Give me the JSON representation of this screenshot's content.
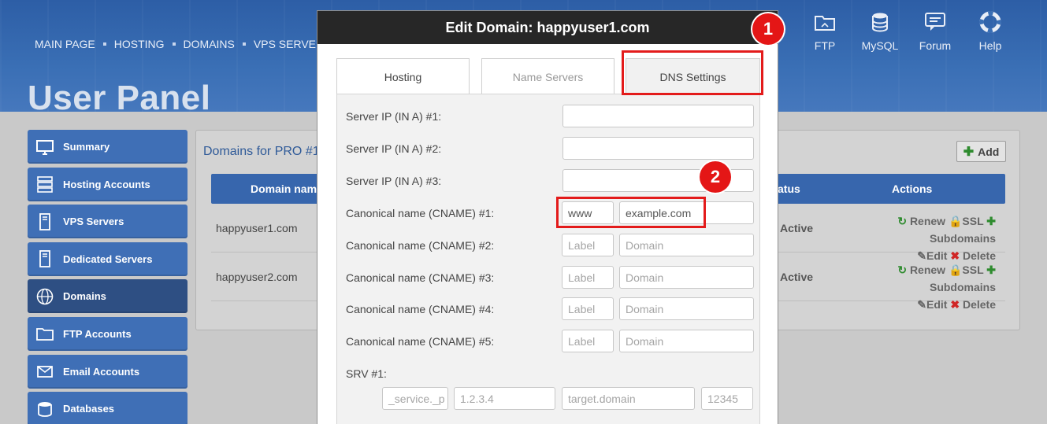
{
  "top_nav": {
    "items": [
      "MAIN PAGE",
      "HOSTING",
      "DOMAINS",
      "VPS SERVERS"
    ]
  },
  "header": {
    "title": "User Panel"
  },
  "top_icons": [
    {
      "label": "FTP",
      "icon": "ftp-folder-icon"
    },
    {
      "label": "MySQL",
      "icon": "database-icon"
    },
    {
      "label": "Forum",
      "icon": "chat-icon"
    },
    {
      "label": "Help",
      "icon": "lifebuoy-icon"
    }
  ],
  "sidebar": {
    "items": [
      {
        "label": "Summary",
        "icon": "monitor-icon"
      },
      {
        "label": "Hosting Accounts",
        "icon": "server-stack-icon"
      },
      {
        "label": "VPS Servers",
        "icon": "server-tower-icon"
      },
      {
        "label": "Dedicated Servers",
        "icon": "server-tower-icon"
      },
      {
        "label": "Domains",
        "icon": "globe-www-icon",
        "active": true
      },
      {
        "label": "FTP Accounts",
        "icon": "ftp-folder-icon"
      },
      {
        "label": "Email Accounts",
        "icon": "envelope-icon"
      },
      {
        "label": "Databases",
        "icon": "database-icon"
      }
    ]
  },
  "main": {
    "title": "Domains for PRO #1",
    "add_label": "Add",
    "columns": {
      "domain": "Domain name",
      "status": "Status",
      "actions": "Actions"
    },
    "rows": [
      {
        "domain": "happyuser1.com",
        "status": "Active"
      },
      {
        "domain": "happyuser2.com",
        "status": "Active"
      }
    ],
    "actions": {
      "renew": "Renew",
      "ssl": "SSL",
      "subdomains": "Subdomains",
      "edit": "Edit",
      "delete": "Delete"
    }
  },
  "modal": {
    "title": "Edit Domain: happyuser1.com",
    "tabs": [
      "Hosting",
      "Name Servers",
      "DNS Settings"
    ],
    "server_ips": [
      {
        "label": "Server IP (IN A) #1:",
        "value": ""
      },
      {
        "label": "Server IP (IN A) #2:",
        "value": ""
      },
      {
        "label": "Server IP (IN A) #3:",
        "value": ""
      }
    ],
    "cnames": [
      {
        "label": "Canonical name (CNAME) #1:",
        "label_value": "www",
        "domain_value": "example.com"
      },
      {
        "label": "Canonical name (CNAME) #2:",
        "label_value": "",
        "domain_value": ""
      },
      {
        "label": "Canonical name (CNAME) #3:",
        "label_value": "",
        "domain_value": ""
      },
      {
        "label": "Canonical name (CNAME) #4:",
        "label_value": "",
        "domain_value": ""
      },
      {
        "label": "Canonical name (CNAME) #5:",
        "label_value": "",
        "domain_value": ""
      }
    ],
    "placeholders": {
      "label": "Label",
      "domain": "Domain"
    },
    "srv": {
      "label": "SRV #1:",
      "service_placeholder": "_service._p",
      "ip_placeholder": "1.2.3.4",
      "target_placeholder": "target.domain",
      "port_placeholder": "12345"
    }
  },
  "callouts": [
    "1",
    "2"
  ],
  "colors": {
    "accent": "#3766ad",
    "sidebar": "#3f6fb6",
    "sidebar_active": "#2e4f83",
    "callout": "#e41616",
    "modal_header": "#272727"
  }
}
